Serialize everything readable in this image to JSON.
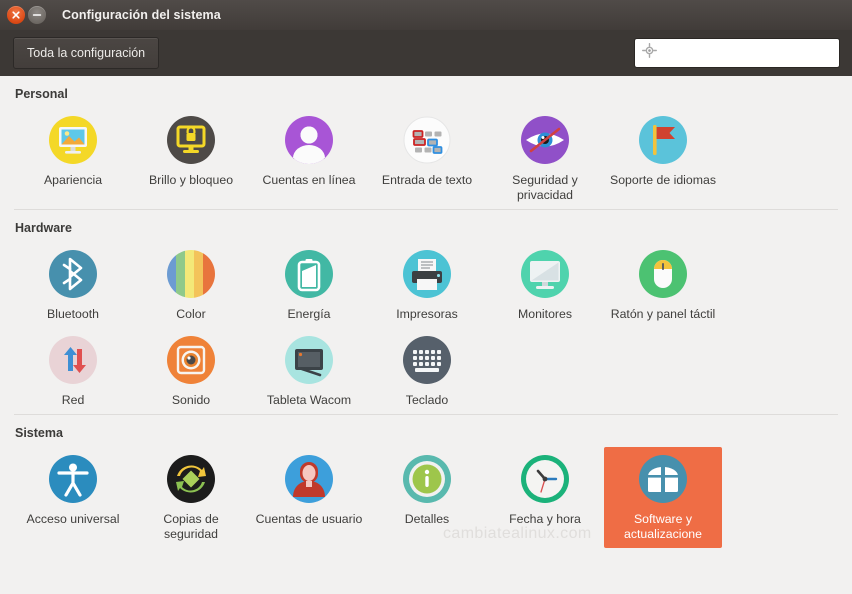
{
  "window": {
    "title": "Configuración del sistema",
    "close_icon": "close-icon",
    "minimize_icon": "minimize-icon"
  },
  "toolbar": {
    "all_settings_label": "Toda la configuración",
    "search_icon": "search-icon",
    "search_value": "",
    "search_placeholder": ""
  },
  "colors": {
    "selection": "#ef6d45",
    "titlebar": "#413c39",
    "content_bg": "#f2f1f0"
  },
  "watermark": "cambiatealinux.com",
  "sections": [
    {
      "title": "Personal",
      "items": [
        {
          "label": "Apariencia",
          "icon": "appearance-icon",
          "selected": false
        },
        {
          "label": "Brillo y bloqueo",
          "icon": "brightness-lock-icon",
          "selected": false
        },
        {
          "label": "Cuentas en línea",
          "icon": "online-accounts-icon",
          "selected": false
        },
        {
          "label": "Entrada de texto",
          "icon": "text-entry-icon",
          "selected": false
        },
        {
          "label": "Seguridad y privacidad",
          "icon": "security-privacy-icon",
          "selected": false
        },
        {
          "label": "Soporte de idiomas",
          "icon": "language-support-icon",
          "selected": false
        }
      ]
    },
    {
      "title": "Hardware",
      "items": [
        {
          "label": "Bluetooth",
          "icon": "bluetooth-icon",
          "selected": false
        },
        {
          "label": "Color",
          "icon": "color-icon",
          "selected": false
        },
        {
          "label": "Energía",
          "icon": "power-icon",
          "selected": false
        },
        {
          "label": "Impresoras",
          "icon": "printers-icon",
          "selected": false
        },
        {
          "label": "Monitores",
          "icon": "displays-icon",
          "selected": false
        },
        {
          "label": "Ratón y panel táctil",
          "icon": "mouse-touchpad-icon",
          "selected": false
        },
        {
          "label": "Red",
          "icon": "network-icon",
          "selected": false
        },
        {
          "label": "Sonido",
          "icon": "sound-icon",
          "selected": false
        },
        {
          "label": "Tableta Wacom",
          "icon": "wacom-tablet-icon",
          "selected": false
        },
        {
          "label": "Teclado",
          "icon": "keyboard-icon",
          "selected": false
        }
      ]
    },
    {
      "title": "Sistema",
      "items": [
        {
          "label": "Acceso universal",
          "icon": "universal-access-icon",
          "selected": false
        },
        {
          "label": "Copias de seguridad",
          "icon": "backups-icon",
          "selected": false
        },
        {
          "label": "Cuentas de usuario",
          "icon": "user-accounts-icon",
          "selected": false
        },
        {
          "label": "Detalles",
          "icon": "details-icon",
          "selected": false
        },
        {
          "label": "Fecha y hora",
          "icon": "date-time-icon",
          "selected": false
        },
        {
          "label": "Software y actualizacione",
          "icon": "software-updates-icon",
          "selected": true
        }
      ]
    }
  ]
}
